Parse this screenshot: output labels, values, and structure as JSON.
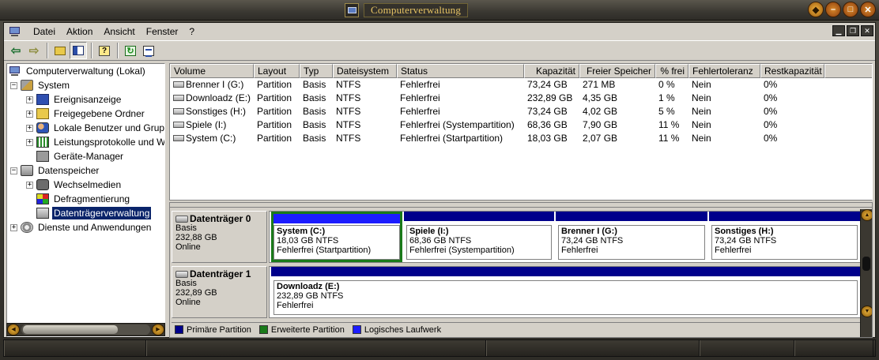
{
  "window": {
    "title": "Computerverwaltung"
  },
  "menu": {
    "items": [
      "Datei",
      "Aktion",
      "Ansicht",
      "Fenster",
      "?"
    ]
  },
  "tree": {
    "items": [
      {
        "label": "Computerverwaltung (Lokal)",
        "icon": "computer-icon"
      },
      {
        "label": "System",
        "icon": "tools-icon"
      },
      {
        "label": "Ereignisanzeige",
        "icon": "event-viewer-icon"
      },
      {
        "label": "Freigegebene Ordner",
        "icon": "shared-folder-icon"
      },
      {
        "label": "Lokale Benutzer und Gruppen",
        "icon": "users-icon"
      },
      {
        "label": "Leistungsprotokolle und Warnungen",
        "icon": "performance-icon"
      },
      {
        "label": "Geräte-Manager",
        "icon": "device-manager-icon"
      },
      {
        "label": "Datenspeicher",
        "icon": "storage-icon"
      },
      {
        "label": "Wechselmedien",
        "icon": "removable-media-icon"
      },
      {
        "label": "Defragmentierung",
        "icon": "defrag-icon"
      },
      {
        "label": "Datenträgerverwaltung",
        "icon": "disk-management-icon"
      },
      {
        "label": "Dienste und Anwendungen",
        "icon": "services-icon"
      }
    ]
  },
  "volumes": {
    "columns": [
      "Volume",
      "Layout",
      "Typ",
      "Dateisystem",
      "Status",
      "Kapazität",
      "Freier Speicher",
      "% frei",
      "Fehlertoleranz",
      "Restkapazität"
    ],
    "rows": [
      [
        "Brenner I (G:)",
        "Partition",
        "Basis",
        "NTFS",
        "Fehlerfrei",
        "73,24 GB",
        "271 MB",
        "0 %",
        "Nein",
        "0%"
      ],
      [
        "Downloadz (E:)",
        "Partition",
        "Basis",
        "NTFS",
        "Fehlerfrei",
        "232,89 GB",
        "4,35 GB",
        "1 %",
        "Nein",
        "0%"
      ],
      [
        "Sonstiges (H:)",
        "Partition",
        "Basis",
        "NTFS",
        "Fehlerfrei",
        "73,24 GB",
        "4,02 GB",
        "5 %",
        "Nein",
        "0%"
      ],
      [
        "Spiele (I:)",
        "Partition",
        "Basis",
        "NTFS",
        "Fehlerfrei (Systempartition)",
        "68,36 GB",
        "7,90 GB",
        "11 %",
        "Nein",
        "0%"
      ],
      [
        "System (C:)",
        "Partition",
        "Basis",
        "NTFS",
        "Fehlerfrei (Startpartition)",
        "18,03 GB",
        "2,07 GB",
        "11 %",
        "Nein",
        "0%"
      ]
    ]
  },
  "disks": [
    {
      "name": "Datenträger 0",
      "type": "Basis",
      "size": "232,88 GB",
      "state": "Online",
      "partitions": [
        {
          "name": "System  (C:)",
          "size": "18,03 GB NTFS",
          "status": "Fehlerfrei (Startpartition)"
        },
        {
          "name": "Spiele  (I:)",
          "size": "68,36 GB NTFS",
          "status": "Fehlerfrei (Systempartition)"
        },
        {
          "name": "Brenner I  (G:)",
          "size": "73,24 GB NTFS",
          "status": "Fehlerfrei"
        },
        {
          "name": "Sonstiges  (H:)",
          "size": "73,24 GB NTFS",
          "status": "Fehlerfrei"
        }
      ]
    },
    {
      "name": "Datenträger 1",
      "type": "Basis",
      "size": "232,89 GB",
      "state": "Online",
      "partitions": [
        {
          "name": "Downloadz  (E:)",
          "size": "232,89 GB NTFS",
          "status": "Fehlerfrei"
        }
      ]
    }
  ],
  "legend": [
    {
      "label": "Primäre Partition",
      "color": "#00008b"
    },
    {
      "label": "Erweiterte Partition",
      "color": "#1a7a1a"
    },
    {
      "label": "Logisches Laufwerk",
      "color": "#1c1cff"
    }
  ]
}
